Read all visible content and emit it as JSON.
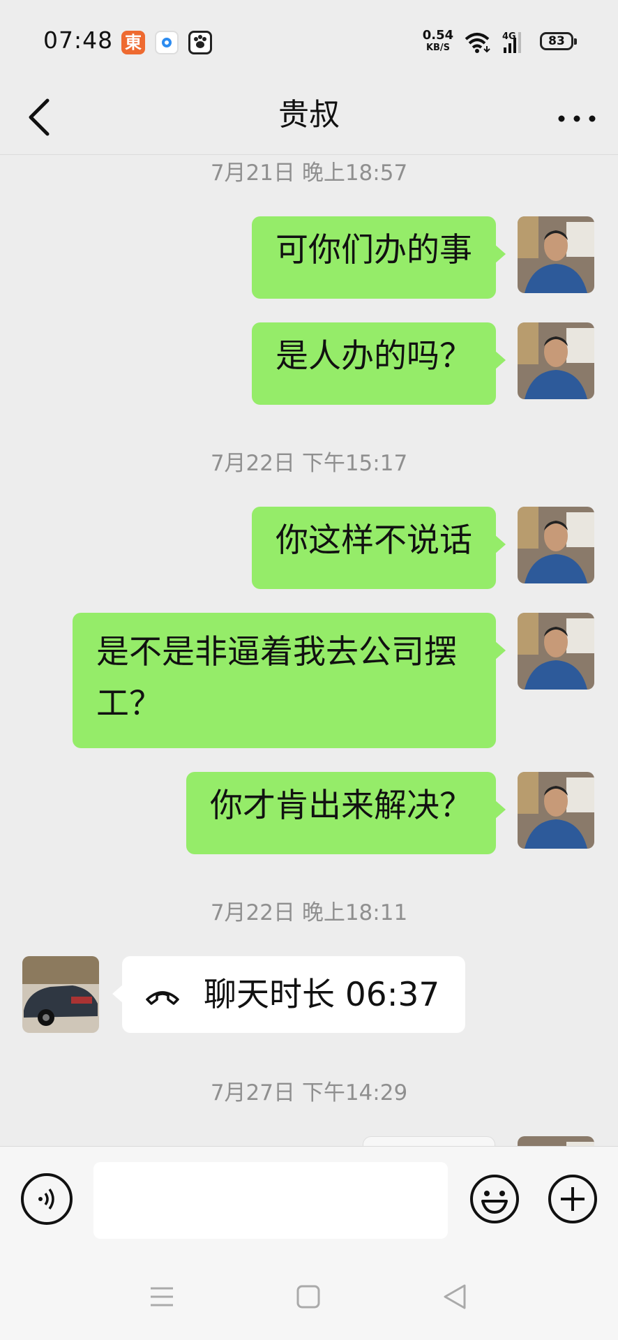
{
  "status_bar": {
    "time": "07:48",
    "app_icons": [
      "jd-icon",
      "browser-icon",
      "baidu-paw-icon"
    ],
    "jd_glyph": "東",
    "net_speed_value": "0.54",
    "net_speed_unit": "KB/S",
    "signal_label": "4G",
    "battery": "83"
  },
  "header": {
    "title": "贵叔",
    "back_icon": "chevron-left-icon",
    "more_icon": "more-dots-icon"
  },
  "messages": [
    {
      "type": "time",
      "text": "7月21日 晚上18:57"
    },
    {
      "type": "text",
      "from": "me",
      "text": "可你们办的事"
    },
    {
      "type": "text",
      "from": "me",
      "text": "是人办的吗？"
    },
    {
      "type": "time",
      "text": "7月22日 下午15:17"
    },
    {
      "type": "text",
      "from": "me",
      "text": "你这样不说话"
    },
    {
      "type": "text",
      "from": "me",
      "text": "是不是非逼着我去公司摆工？"
    },
    {
      "type": "text",
      "from": "me",
      "text": "你才肯出来解决？"
    },
    {
      "type": "time",
      "text": "7月22日 晚上18:11"
    },
    {
      "type": "call",
      "from": "other",
      "text": "聊天时长 06:37"
    },
    {
      "type": "time",
      "text": "7月27日 下午14:29"
    }
  ],
  "input_bar": {
    "voice_icon": "voice-icon",
    "text_value": "",
    "emoji_icon": "emoji-icon",
    "plus_icon": "plus-icon"
  },
  "system_nav": [
    "menu-icon",
    "home-icon",
    "back-triangle-icon"
  ],
  "colors": {
    "background": "#ededed",
    "my_bubble": "#95ec69",
    "other_bubble": "#ffffff",
    "timestamp": "#8f8f8f"
  }
}
